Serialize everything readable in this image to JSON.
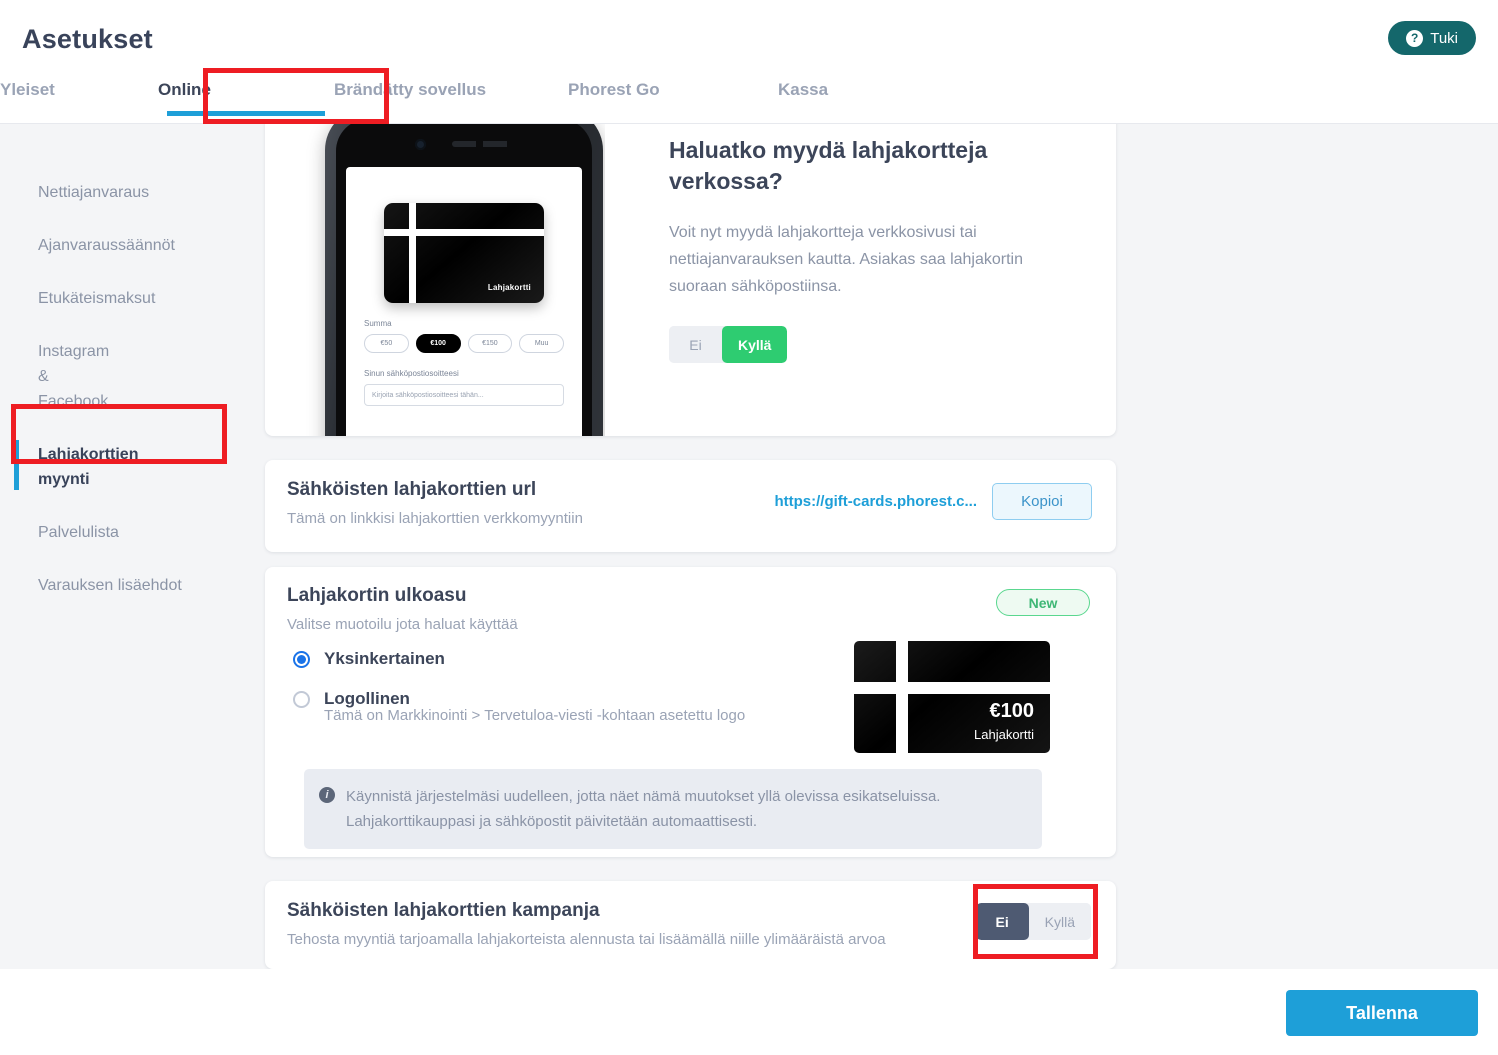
{
  "header": {
    "title": "Asetukset",
    "support_label": "Tuki",
    "support_icon": "question-circle-icon",
    "support_color": "#14676b"
  },
  "tabs": [
    {
      "label": "Yleiset",
      "active": false
    },
    {
      "label": "Online",
      "active": true
    },
    {
      "label": "Brändätty sovellus",
      "active": false
    },
    {
      "label": "Phorest Go",
      "active": false
    },
    {
      "label": "Kassa",
      "active": false
    }
  ],
  "sidebar": {
    "items": [
      {
        "label": "Nettiajanvaraus",
        "active": false
      },
      {
        "label": "Ajanvaraussäännöt",
        "active": false
      },
      {
        "label": "Etukäteismaksut",
        "active": false
      },
      {
        "label": "Instagram & Facebook",
        "active": false
      },
      {
        "label": "Lahjakorttien myynti",
        "active": true
      },
      {
        "label": "Palvelulista",
        "active": false
      },
      {
        "label": "Varauksen lisäehdot",
        "active": false
      }
    ]
  },
  "hero": {
    "title": "Haluatko myydä lahjakortteja verkossa?",
    "description": "Voit nyt myydä lahjakortteja verkkosivusi tai nettiajanvarauksen kautta. Asiakas saa lahjakortin suoraan sähköpostiinsa.",
    "toggle": {
      "no_label": "Ei",
      "yes_label": "Kyllä",
      "selected": "Kyllä",
      "on_color": "#2ecc71"
    },
    "phone_preview": {
      "card_label": "Lahjakortti",
      "amount_label": "Summa",
      "amounts": [
        "€50",
        "€100",
        "€150",
        "Muu"
      ],
      "selected_amount": "€100",
      "email_label": "Sinun sähköpostiosoitteesi",
      "email_placeholder": "Kirjoita sähköpostiosoitteesi tähän..."
    }
  },
  "url_card": {
    "title": "Sähköisten lahjakorttien url",
    "subtitle": "Tämä on linkkisi lahjakorttien verkkomyyntiin",
    "url": "https://gift-cards.phorest.c...",
    "copy_label": "Kopioi",
    "link_color": "#1e9fd8"
  },
  "look_card": {
    "title": "Lahjakortin ulkoasu",
    "subtitle": "Valitse muotoilu jota haluat käyttää",
    "badge": "New",
    "options": [
      {
        "label": "Yksinkertainen",
        "selected": true,
        "hint": ""
      },
      {
        "label": "Logollinen",
        "selected": false,
        "hint": "Tämä on Markkinointi > Tervetuloa-viesti -kohtaan asetettu logo"
      }
    ],
    "info_icon": "info-icon",
    "info_text": "Käynnistä järjestelmäsi uudelleen, jotta näet nämä muutokset yllä olevissa esikatseluissa. Lahjakorttikauppasi ja sähköpostit päivitetään automaattisesti.",
    "preview": {
      "amount": "€100",
      "caption": "Lahjakortti"
    }
  },
  "campaign_card": {
    "title": "Sähköisten lahjakorttien kampanja",
    "subtitle": "Tehosta myyntiä tarjoamalla lahjakorteista alennusta tai lisäämällä niille ylimääräistä arvoa",
    "toggle": {
      "no_label": "Ei",
      "yes_label": "Kyllä",
      "selected": "Ei",
      "on_color": "#4e5a72"
    }
  },
  "footer": {
    "save_label": "Tallenna",
    "save_color": "#1e9fd8"
  },
  "annotations": {
    "color": "#ee1d23",
    "count": 3
  }
}
